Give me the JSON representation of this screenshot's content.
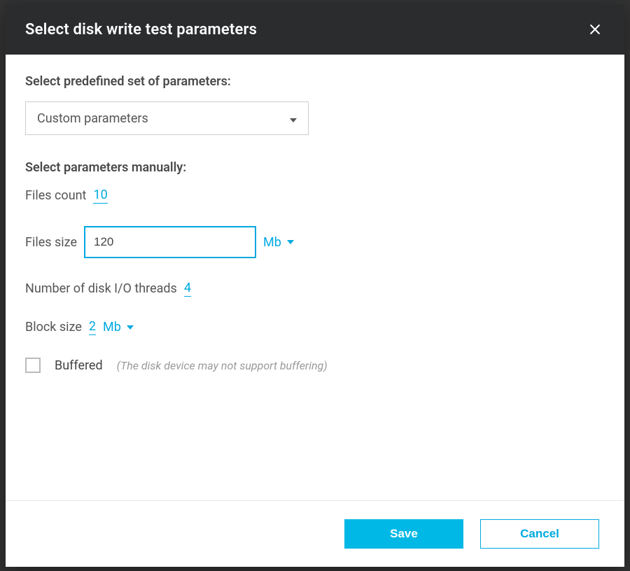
{
  "modal": {
    "title": "Select disk write test parameters",
    "predefined_label": "Select predefined set of parameters:",
    "dropdown_value": "Custom parameters",
    "manual_label": "Select parameters manually:",
    "files_count_label": "Files count",
    "files_count_value": "10",
    "files_size_label": "Files size",
    "files_size_value": "120",
    "files_size_unit": "Mb",
    "threads_label": "Number of disk I/O threads",
    "threads_value": "4",
    "block_size_label": "Block size",
    "block_size_value": "2",
    "block_size_unit": "Mb",
    "buffered_label": "Buffered",
    "buffered_hint": "(The disk device may not support buffering)"
  },
  "footer": {
    "save": "Save",
    "cancel": "Cancel"
  }
}
